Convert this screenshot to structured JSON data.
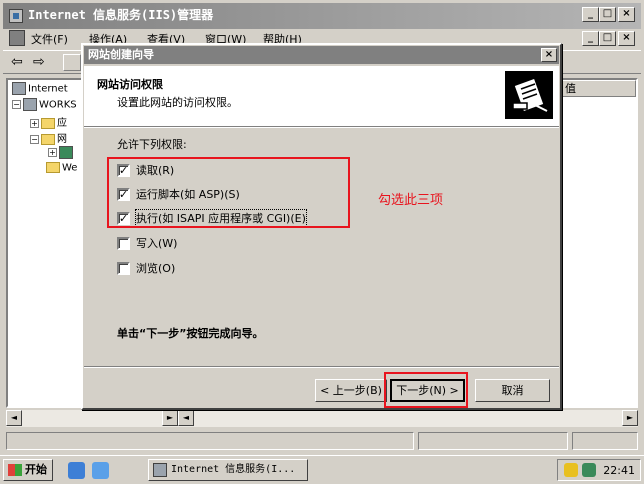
{
  "main_window": {
    "title": "Internet 信息服务(IIS)管理器",
    "minimize": "_",
    "maximize": "□",
    "close": "×",
    "menu": [
      "文件(F)",
      "操作(A)",
      "查看(V)",
      "窗口(W)",
      "帮助(H)"
    ],
    "child_controls": [
      "_",
      "□",
      "×"
    ]
  },
  "tree": {
    "items": [
      {
        "label": "Internet",
        "box": ""
      },
      {
        "label": "WORKS",
        "box": "−"
      },
      {
        "label": "应",
        "box": "+"
      },
      {
        "label": "网",
        "box": "−"
      },
      {
        "label": "",
        "box": "+"
      },
      {
        "label": "We",
        "box": ""
      }
    ]
  },
  "list": {
    "column_header": "值"
  },
  "dialog": {
    "title": "网站创建向导",
    "close": "×",
    "heading": "网站访问权限",
    "subheading": "设置此网站的访问权限。",
    "intro": "允许下列权限:",
    "permissions": [
      {
        "label": "读取(R)",
        "checked": true
      },
      {
        "label": "运行脚本(如 ASP)(S)",
        "checked": true
      },
      {
        "label": "执行(如 ISAPI 应用程序或 CGI)(E)",
        "checked": true
      },
      {
        "label": "写入(W)",
        "checked": false
      },
      {
        "label": "浏览(O)",
        "checked": false
      }
    ],
    "finish_note": "单击“下一步”按钮完成向导。",
    "buttons": {
      "back": "< 上一步(B)",
      "next": "下一步(N) >",
      "cancel": "取消"
    }
  },
  "annotation": {
    "note": "勾选此三项",
    "color": "#e8141e"
  },
  "taskbar": {
    "start": "开始",
    "task_button": "Internet 信息服务(I...",
    "clock": "22:41"
  },
  "scrollbar": {
    "left": "◄",
    "right": "►"
  }
}
